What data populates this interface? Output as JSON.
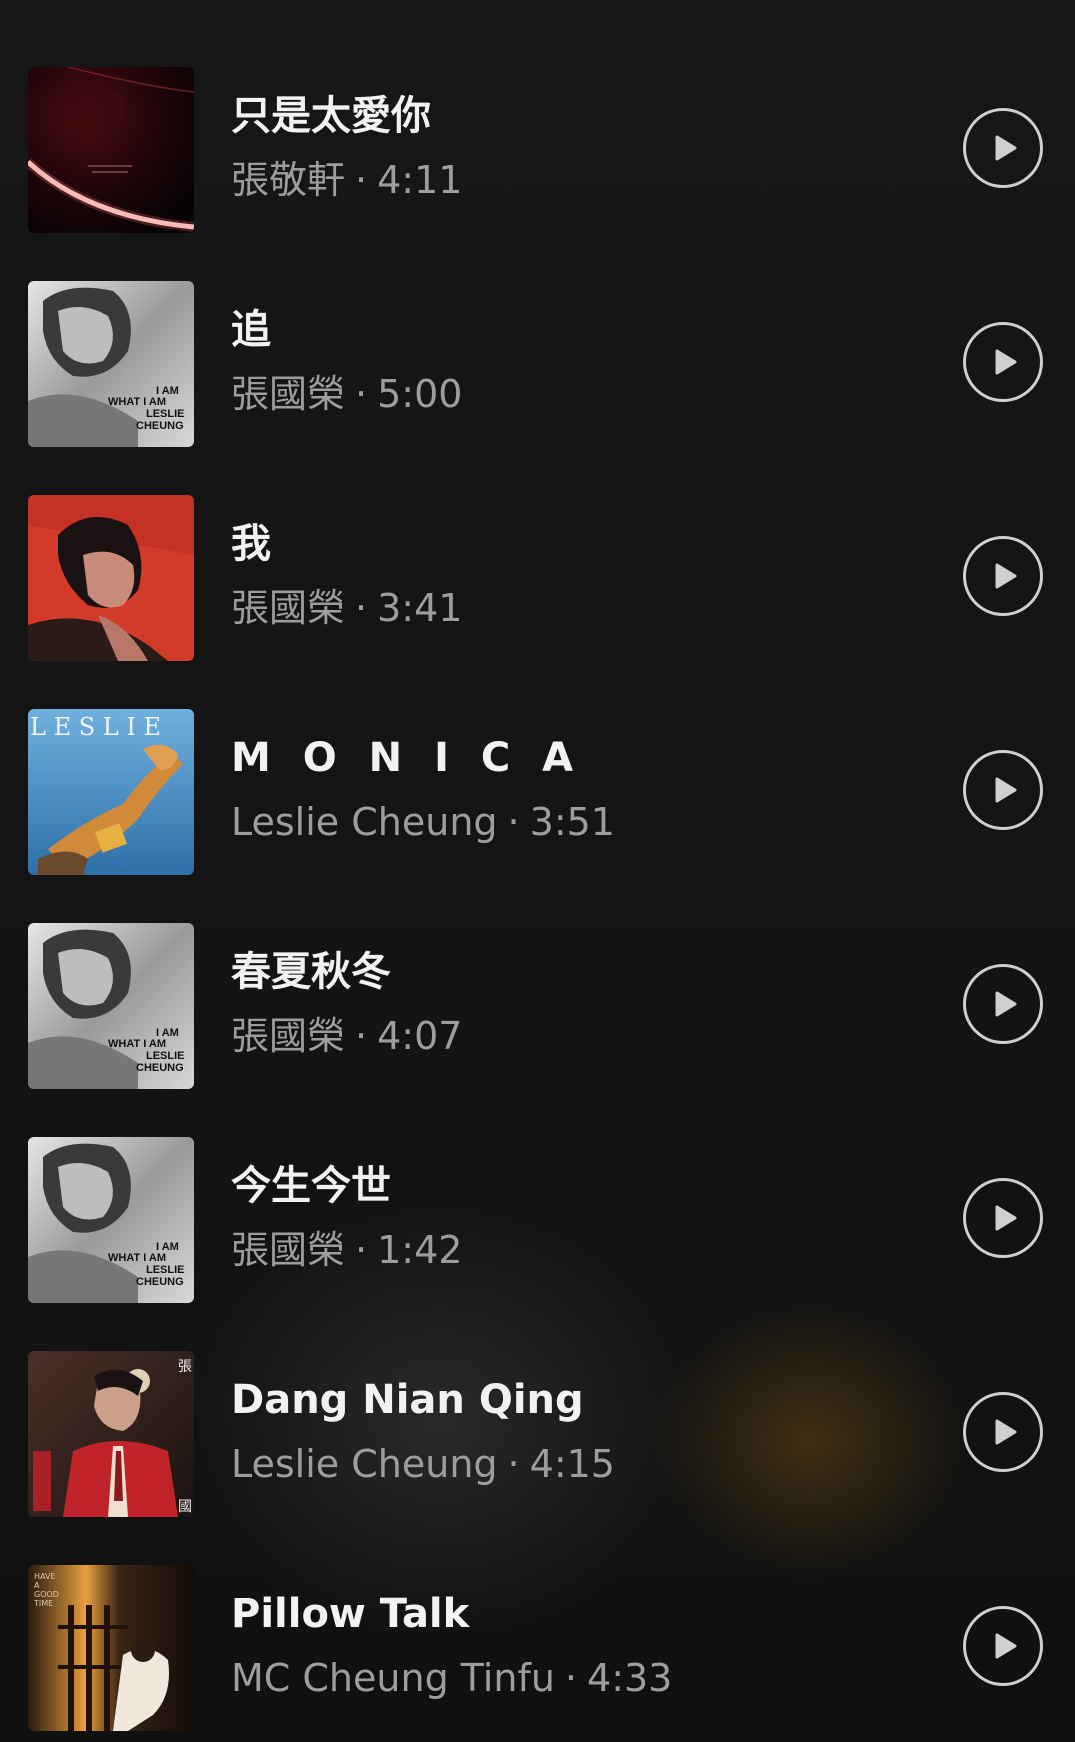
{
  "tracks": [
    {
      "title": "只是太愛你",
      "artist": "張敬軒",
      "separator": "·",
      "duration": "4:11",
      "cover": "dark-red-arc-cover"
    },
    {
      "title": "追",
      "artist": "張國榮",
      "separator": "·",
      "duration": "5:00",
      "cover": "what-i-am-cover"
    },
    {
      "title": "我",
      "artist": "張國榮",
      "separator": "·",
      "duration": "3:41",
      "cover": "red-portrait-cover"
    },
    {
      "title": "M O N I C A",
      "artist": "Leslie Cheung",
      "separator": "·",
      "duration": "3:51",
      "cover": "leslie-blue-cover"
    },
    {
      "title": "春夏秋冬",
      "artist": "張國榮",
      "separator": "·",
      "duration": "4:07",
      "cover": "what-i-am-cover"
    },
    {
      "title": "今生今世",
      "artist": "張國榮",
      "separator": "·",
      "duration": "1:42",
      "cover": "what-i-am-cover"
    },
    {
      "title": "Dang Nian Qing",
      "artist": "Leslie Cheung",
      "separator": "·",
      "duration": "4:15",
      "cover": "red-suit-cover"
    },
    {
      "title": "Pillow Talk",
      "artist": "MC Cheung Tinfu",
      "separator": "·",
      "duration": "4:33",
      "cover": "have-a-good-time-cover"
    }
  ],
  "covers": {
    "what_i_am": {
      "line1": "I AM",
      "line2": "WHAT I AM",
      "line3": "LESLIE",
      "line4": "CHEUNG"
    },
    "leslie": {
      "text": "L E S L I E"
    },
    "red_suit": {
      "glyph_top": "張",
      "glyph_bottom": "國"
    },
    "good_time": {
      "line1": "HAVE",
      "line2": "A",
      "line3": "GOOD",
      "line4": "TIME"
    }
  },
  "colors": {
    "background": "#141414",
    "title": "#f2f2f2",
    "subtitle": "#9d9d9d",
    "play_ring": "#cfcfcf"
  }
}
